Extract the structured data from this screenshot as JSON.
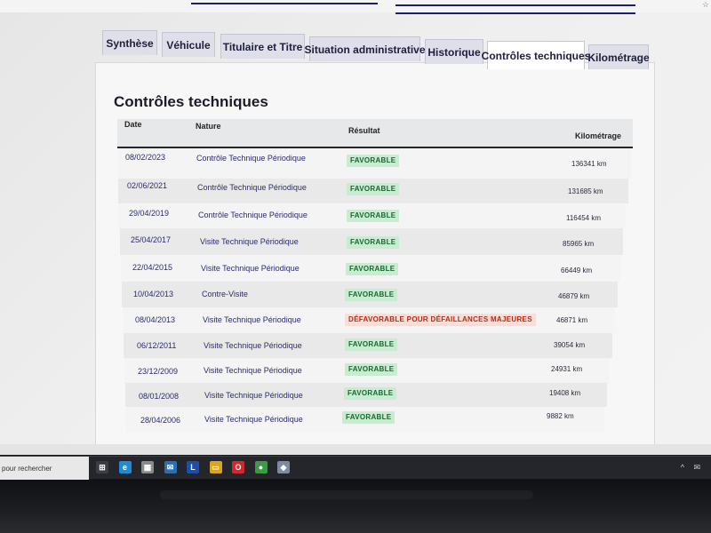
{
  "tabs": [
    {
      "label": "Synthèse"
    },
    {
      "label": "Véhicule"
    },
    {
      "label": "Titulaire et Titre"
    },
    {
      "label": "Situation administrative"
    },
    {
      "label": "Historique"
    },
    {
      "label": "Contrôles techniques"
    },
    {
      "label": "Kilométrage"
    }
  ],
  "section": {
    "title": "Contrôles techniques"
  },
  "table": {
    "headers": {
      "date": "Date",
      "nature": "Nature",
      "resultat": "Résultat",
      "km": "Kilométrage"
    },
    "rows": [
      {
        "date": "08/02/2023",
        "nature": "Contrôle Technique Périodique",
        "resultat": "FAVORABLE",
        "km": "136341 km"
      },
      {
        "date": "02/06/2021",
        "nature": "Contrôle Technique Périodique",
        "resultat": "FAVORABLE",
        "km": "131685 km"
      },
      {
        "date": "29/04/2019",
        "nature": "Contrôle Technique Périodique",
        "resultat": "FAVORABLE",
        "km": "116454 km"
      },
      {
        "date": "25/04/2017",
        "nature": "Visite Technique Périodique",
        "resultat": "FAVORABLE",
        "km": "85965 km"
      },
      {
        "date": "22/04/2015",
        "nature": "Visite Technique Périodique",
        "resultat": "FAVORABLE",
        "km": "66449 km"
      },
      {
        "date": "10/04/2013",
        "nature": "Contre-Visite",
        "resultat": "FAVORABLE",
        "km": "46879 km"
      },
      {
        "date": "08/04/2013",
        "nature": "Visite Technique Périodique",
        "resultat": "DÉFAVORABLE POUR DÉFAILLANCES MAJEURES",
        "km": "46871 km"
      },
      {
        "date": "06/12/2011",
        "nature": "Visite Technique Périodique",
        "resultat": "FAVORABLE",
        "km": "39054 km"
      },
      {
        "date": "23/12/2009",
        "nature": "Visite Technique Périodique",
        "resultat": "FAVORABLE",
        "km": "24931 km"
      },
      {
        "date": "08/01/2008",
        "nature": "Visite Technique Périodique",
        "resultat": "FAVORABLE",
        "km": "19408 km"
      },
      {
        "date": "28/04/2006",
        "nature": "Visite Technique Périodique",
        "resultat": "FAVORABLE",
        "km": "9882 km"
      }
    ]
  },
  "taskbar": {
    "search_text": "pour rechercher",
    "icons": [
      {
        "name": "task-view-icon",
        "glyph": "⊞",
        "color": "#3a3d44"
      },
      {
        "name": "edge-icon",
        "glyph": "e",
        "color": "#1f8ad6"
      },
      {
        "name": "calculator-icon",
        "glyph": "▦",
        "color": "#8a8a8a"
      },
      {
        "name": "mail-icon",
        "glyph": "✉",
        "color": "#2a6fb5"
      },
      {
        "name": "l-app-icon",
        "glyph": "L",
        "color": "#1d4fa8"
      },
      {
        "name": "file-explorer-icon",
        "glyph": "▭",
        "color": "#d9a520"
      },
      {
        "name": "opera-icon",
        "glyph": "O",
        "color": "#d3262d"
      },
      {
        "name": "chrome-icon",
        "glyph": "●",
        "color": "#3b9a43"
      },
      {
        "name": "app-icon",
        "glyph": "◆",
        "color": "#7b8ba3"
      }
    ],
    "tray": "^ ✉"
  },
  "colors": {
    "favorable_bg": "#c9ecd1",
    "favorable_text": "#16692e",
    "defavorable_bg": "#f7ded8",
    "defavorable_text": "#b12b15",
    "tab_text": "#202040"
  }
}
